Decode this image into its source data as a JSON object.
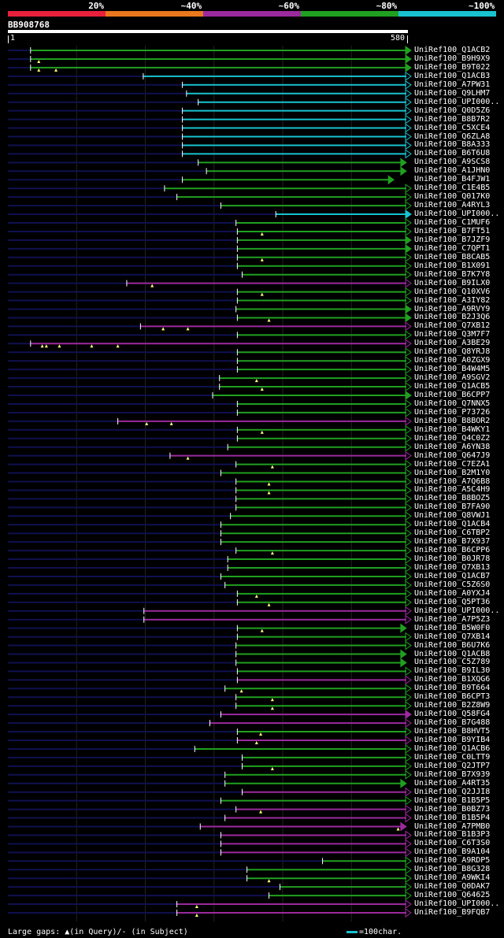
{
  "legend": [
    {
      "label": "20%",
      "color": "#e8203c"
    },
    {
      "label": "~40%",
      "color": "#e9781e"
    },
    {
      "label": "~60%",
      "color": "#9b2a9e"
    },
    {
      "label": "~80%",
      "color": "#20a020"
    },
    {
      "label": "~100%",
      "color": "#19c2cf"
    }
  ],
  "query": {
    "id": "BB908768",
    "start_label": "1",
    "end_label": "580",
    "length": 580
  },
  "colors": {
    "green": "#20a020",
    "cyan": "#19c2cf",
    "purple": "#9b2a9e",
    "tail": "#101050",
    "marker": "#ffff80",
    "grid": "#222222"
  },
  "hits": [
    {
      "label": "UniRef100_Q1ACB2",
      "start": 33,
      "end": 580,
      "color": "green",
      "arrow": true,
      "markers": []
    },
    {
      "label": "UniRef100_B9H9X9",
      "start": 33,
      "end": 580,
      "color": "green",
      "arrow": true,
      "markers": [
        45
      ]
    },
    {
      "label": "UniRef100_B9T022",
      "start": 33,
      "end": 580,
      "color": "green",
      "arrow": true,
      "markers": [
        45,
        70
      ]
    },
    {
      "label": "UniRef100_Q1ACB3",
      "start": 197,
      "end": 580,
      "color": "cyan",
      "arrow": false,
      "markers": []
    },
    {
      "label": "UniRef100_A7PW31",
      "start": 254,
      "end": 580,
      "color": "cyan",
      "arrow": false,
      "markers": []
    },
    {
      "label": "UniRef100_Q9LHM7",
      "start": 260,
      "end": 580,
      "color": "cyan",
      "arrow": false,
      "markers": []
    },
    {
      "label": "UniRef100_UPI000..",
      "start": 277,
      "end": 580,
      "color": "cyan",
      "arrow": false,
      "markers": []
    },
    {
      "label": "UniRef100_Q0D5Z6",
      "start": 254,
      "end": 580,
      "color": "cyan",
      "arrow": false,
      "markers": []
    },
    {
      "label": "UniRef100_B8B7R2",
      "start": 254,
      "end": 580,
      "color": "cyan",
      "arrow": false,
      "markers": []
    },
    {
      "label": "UniRef100_C5XCE4",
      "start": 254,
      "end": 580,
      "color": "cyan",
      "arrow": false,
      "markers": []
    },
    {
      "label": "UniRef100_Q6ZLA8",
      "start": 254,
      "end": 580,
      "color": "cyan",
      "arrow": false,
      "markers": []
    },
    {
      "label": "UniRef100_B8A333",
      "start": 254,
      "end": 580,
      "color": "cyan",
      "arrow": false,
      "markers": []
    },
    {
      "label": "UniRef100_B6T6U8",
      "start": 254,
      "end": 580,
      "color": "cyan",
      "arrow": false,
      "markers": []
    },
    {
      "label": "UniRef100_A9SCS8",
      "start": 277,
      "end": 573,
      "color": "green",
      "arrow": true,
      "markers": []
    },
    {
      "label": "UniRef100_A1JHN0",
      "start": 289,
      "end": 573,
      "color": "green",
      "arrow": true,
      "markers": []
    },
    {
      "label": "UniRef100_B4FJW1",
      "start": 254,
      "end": 555,
      "color": "green",
      "arrow": true,
      "markers": []
    },
    {
      "label": "UniRef100_C1E4B5",
      "start": 228,
      "end": 580,
      "color": "green",
      "arrow": false,
      "markers": []
    },
    {
      "label": "UniRef100_Q017K0",
      "start": 246,
      "end": 580,
      "color": "green",
      "arrow": false,
      "markers": []
    },
    {
      "label": "UniRef100_A4RYL3",
      "start": 310,
      "end": 580,
      "color": "green",
      "arrow": false,
      "markers": []
    },
    {
      "label": "UniRef100_UPI000..",
      "start": 390,
      "end": 580,
      "color": "cyan",
      "arrow": true,
      "markers": []
    },
    {
      "label": "UniRef100_C1MUF6",
      "start": 332,
      "end": 580,
      "color": "green",
      "arrow": false,
      "markers": []
    },
    {
      "label": "UniRef100_B7FT51",
      "start": 334,
      "end": 580,
      "color": "green",
      "arrow": false,
      "markers": [
        370
      ]
    },
    {
      "label": "UniRef100_B7JZF9",
      "start": 334,
      "end": 580,
      "color": "green",
      "arrow": true,
      "markers": []
    },
    {
      "label": "UniRef100_C7QPT1",
      "start": 334,
      "end": 580,
      "color": "green",
      "arrow": true,
      "markers": []
    },
    {
      "label": "UniRef100_B8CAB5",
      "start": 334,
      "end": 580,
      "color": "green",
      "arrow": false,
      "markers": [
        370
      ]
    },
    {
      "label": "UniRef100_B1X091",
      "start": 334,
      "end": 580,
      "color": "green",
      "arrow": false,
      "markers": []
    },
    {
      "label": "UniRef100_B7K7Y8",
      "start": 341,
      "end": 580,
      "color": "green",
      "arrow": false,
      "markers": []
    },
    {
      "label": "UniRef100_B9ILX0",
      "start": 173,
      "end": 580,
      "color": "purple",
      "arrow": false,
      "markers": [
        210
      ]
    },
    {
      "label": "UniRef100_Q10XV6",
      "start": 334,
      "end": 580,
      "color": "green",
      "arrow": false,
      "markers": [
        370
      ]
    },
    {
      "label": "UniRef100_A3IY82",
      "start": 334,
      "end": 580,
      "color": "green",
      "arrow": false,
      "markers": []
    },
    {
      "label": "UniRef100_A9RVY9",
      "start": 332,
      "end": 580,
      "color": "green",
      "arrow": true,
      "markers": []
    },
    {
      "label": "UniRef100_B2J3Q6",
      "start": 334,
      "end": 580,
      "color": "green",
      "arrow": true,
      "markers": [
        380
      ]
    },
    {
      "label": "UniRef100_Q7XB12",
      "start": 193,
      "end": 580,
      "color": "purple",
      "arrow": false,
      "markers": [
        226,
        262
      ]
    },
    {
      "label": "UniRef100_Q3M7F7",
      "start": 334,
      "end": 580,
      "color": "green",
      "arrow": false,
      "markers": []
    },
    {
      "label": "UniRef100_A3BE29",
      "start": 33,
      "end": 580,
      "color": "purple",
      "arrow": false,
      "markers": [
        50,
        56,
        75,
        122,
        160
      ]
    },
    {
      "label": "UniRef100_Q8YRJ8",
      "start": 334,
      "end": 580,
      "color": "green",
      "arrow": false,
      "markers": []
    },
    {
      "label": "UniRef100_A0ZGX9",
      "start": 334,
      "end": 580,
      "color": "green",
      "arrow": false,
      "markers": []
    },
    {
      "label": "UniRef100_B4W4M5",
      "start": 334,
      "end": 580,
      "color": "green",
      "arrow": false,
      "markers": []
    },
    {
      "label": "UniRef100_A9SGV2",
      "start": 308,
      "end": 580,
      "color": "green",
      "arrow": false,
      "markers": [
        362
      ]
    },
    {
      "label": "UniRef100_Q1ACB5",
      "start": 308,
      "end": 580,
      "color": "green",
      "arrow": false,
      "markers": [
        370
      ]
    },
    {
      "label": "UniRef100_B6CPP7",
      "start": 298,
      "end": 580,
      "color": "green",
      "arrow": true,
      "markers": []
    },
    {
      "label": "UniRef100_Q7NNX5",
      "start": 334,
      "end": 580,
      "color": "green",
      "arrow": false,
      "markers": []
    },
    {
      "label": "UniRef100_P73726",
      "start": 334,
      "end": 580,
      "color": "green",
      "arrow": false,
      "markers": []
    },
    {
      "label": "UniRef100_B8BOR2",
      "start": 160,
      "end": 580,
      "color": "purple",
      "arrow": false,
      "markers": [
        202,
        238
      ]
    },
    {
      "label": "UniRef100_B4WKY1",
      "start": 334,
      "end": 580,
      "color": "green",
      "arrow": false,
      "markers": [
        370
      ]
    },
    {
      "label": "UniRef100_Q4C0Z2",
      "start": 334,
      "end": 580,
      "color": "green",
      "arrow": false,
      "markers": []
    },
    {
      "label": "UniRef100_A6YN38",
      "start": 320,
      "end": 580,
      "color": "green",
      "arrow": false,
      "markers": []
    },
    {
      "label": "UniRef100_Q647J9",
      "start": 236,
      "end": 580,
      "color": "purple",
      "arrow": false,
      "markers": [
        262
      ]
    },
    {
      "label": "UniRef100_C7EZA1",
      "start": 332,
      "end": 580,
      "color": "green",
      "arrow": false,
      "markers": [
        385
      ]
    },
    {
      "label": "UniRef100_B2M1Y0",
      "start": 310,
      "end": 580,
      "color": "green",
      "arrow": false,
      "markers": []
    },
    {
      "label": "UniRef100_A7Q6B8",
      "start": 332,
      "end": 580,
      "color": "green",
      "arrow": false,
      "markers": [
        380
      ]
    },
    {
      "label": "UniRef100_A5C4H9",
      "start": 332,
      "end": 580,
      "color": "green",
      "arrow": false,
      "markers": [
        380
      ]
    },
    {
      "label": "UniRef100_B8BOZ5",
      "start": 332,
      "end": 580,
      "color": "green",
      "arrow": false,
      "markers": []
    },
    {
      "label": "UniRef100_B7FA90",
      "start": 332,
      "end": 580,
      "color": "green",
      "arrow": false,
      "markers": []
    },
    {
      "label": "UniRef100_Q8VWJ1",
      "start": 324,
      "end": 580,
      "color": "green",
      "arrow": false,
      "markers": []
    },
    {
      "label": "UniRef100_Q1ACB4",
      "start": 310,
      "end": 580,
      "color": "green",
      "arrow": false,
      "markers": []
    },
    {
      "label": "UniRef100_C6TBP2",
      "start": 310,
      "end": 580,
      "color": "green",
      "arrow": false,
      "markers": []
    },
    {
      "label": "UniRef100_B7X937",
      "start": 310,
      "end": 580,
      "color": "green",
      "arrow": false,
      "markers": []
    },
    {
      "label": "UniRef100_B6CPP6",
      "start": 332,
      "end": 580,
      "color": "green",
      "arrow": false,
      "markers": [
        385
      ]
    },
    {
      "label": "UniRef100_B0JR78",
      "start": 320,
      "end": 580,
      "color": "green",
      "arrow": false,
      "markers": []
    },
    {
      "label": "UniRef100_Q7XB13",
      "start": 320,
      "end": 580,
      "color": "green",
      "arrow": false,
      "markers": []
    },
    {
      "label": "UniRef100_Q1ACB7",
      "start": 310,
      "end": 580,
      "color": "green",
      "arrow": false,
      "markers": []
    },
    {
      "label": "UniRef100_C5Z6S0",
      "start": 316,
      "end": 580,
      "color": "green",
      "arrow": false,
      "markers": []
    },
    {
      "label": "UniRef100_A0YXJ4",
      "start": 334,
      "end": 580,
      "color": "green",
      "arrow": false,
      "markers": [
        362
      ]
    },
    {
      "label": "UniRef100_Q5PT36",
      "start": 334,
      "end": 580,
      "color": "green",
      "arrow": false,
      "markers": [
        380
      ]
    },
    {
      "label": "UniRef100_UPI000..",
      "start": 198,
      "end": 580,
      "color": "purple",
      "arrow": false,
      "markers": []
    },
    {
      "label": "UniRef100_A7P5Z3",
      "start": 198,
      "end": 580,
      "color": "purple",
      "arrow": false,
      "markers": []
    },
    {
      "label": "UniRef100_B5W0F0",
      "start": 334,
      "end": 573,
      "color": "green",
      "arrow": true,
      "markers": [
        370
      ]
    },
    {
      "label": "UniRef100_Q7XB14",
      "start": 334,
      "end": 580,
      "color": "green",
      "arrow": false,
      "markers": []
    },
    {
      "label": "UniRef100_B6U7K6",
      "start": 332,
      "end": 580,
      "color": "green",
      "arrow": false,
      "markers": []
    },
    {
      "label": "UniRef100_Q1ACB8",
      "start": 332,
      "end": 573,
      "color": "green",
      "arrow": true,
      "markers": []
    },
    {
      "label": "UniRef100_C5Z789",
      "start": 332,
      "end": 573,
      "color": "green",
      "arrow": true,
      "markers": []
    },
    {
      "label": "UniRef100_B9IL30",
      "start": 334,
      "end": 580,
      "color": "green",
      "arrow": false,
      "markers": []
    },
    {
      "label": "UniRef100_B1XQG6",
      "start": 334,
      "end": 580,
      "color": "purple",
      "arrow": false,
      "markers": []
    },
    {
      "label": "UniRef100_B9T664",
      "start": 316,
      "end": 580,
      "color": "green",
      "arrow": false,
      "markers": [
        340
      ]
    },
    {
      "label": "UniRef100_B6CPT3",
      "start": 332,
      "end": 580,
      "color": "green",
      "arrow": false,
      "markers": [
        385
      ]
    },
    {
      "label": "UniRef100_B2Z8W9",
      "start": 332,
      "end": 580,
      "color": "green",
      "arrow": false,
      "markers": [
        385
      ]
    },
    {
      "label": "UniRef100_Q58FG4",
      "start": 310,
      "end": 580,
      "color": "purple",
      "arrow": true,
      "markers": []
    },
    {
      "label": "UniRef100_B7G488",
      "start": 294,
      "end": 580,
      "color": "purple",
      "arrow": false,
      "markers": []
    },
    {
      "label": "UniRef100_B8HVT5",
      "start": 334,
      "end": 580,
      "color": "green",
      "arrow": false,
      "markers": [
        368
      ]
    },
    {
      "label": "UniRef100_B9YIB4",
      "start": 334,
      "end": 580,
      "color": "purple",
      "arrow": false,
      "markers": [
        362
      ]
    },
    {
      "label": "UniRef100_Q1ACB6",
      "start": 272,
      "end": 580,
      "color": "green",
      "arrow": false,
      "markers": []
    },
    {
      "label": "UniRef100_C0LTT9",
      "start": 341,
      "end": 580,
      "color": "green",
      "arrow": false,
      "markers": []
    },
    {
      "label": "UniRef100_Q2JTP7",
      "start": 341,
      "end": 580,
      "color": "green",
      "arrow": false,
      "markers": [
        385
      ]
    },
    {
      "label": "UniRef100_B7X939",
      "start": 316,
      "end": 580,
      "color": "green",
      "arrow": false,
      "markers": []
    },
    {
      "label": "UniRef100_A4RT35",
      "start": 316,
      "end": 573,
      "color": "green",
      "arrow": true,
      "markers": []
    },
    {
      "label": "UniRef100_Q2JJI8",
      "start": 341,
      "end": 580,
      "color": "purple",
      "arrow": false,
      "markers": []
    },
    {
      "label": "UniRef100_B1B5P5",
      "start": 310,
      "end": 580,
      "color": "green",
      "arrow": false,
      "markers": []
    },
    {
      "label": "UniRef100_B0BZ73",
      "start": 332,
      "end": 580,
      "color": "purple",
      "arrow": false,
      "markers": [
        368
      ]
    },
    {
      "label": "UniRef100_B1B5P4",
      "start": 316,
      "end": 580,
      "color": "purple",
      "arrow": false,
      "markers": []
    },
    {
      "label": "UniRef100_A7PMB0",
      "start": 280,
      "end": 573,
      "color": "purple",
      "arrow": true,
      "markers": [
        568
      ]
    },
    {
      "label": "UniRef100_B1B3P3",
      "start": 310,
      "end": 580,
      "color": "purple",
      "arrow": false,
      "markers": []
    },
    {
      "label": "UniRef100_C6T3S0",
      "start": 310,
      "end": 580,
      "color": "purple",
      "arrow": false,
      "markers": []
    },
    {
      "label": "UniRef100_B9A104",
      "start": 310,
      "end": 580,
      "color": "purple",
      "arrow": false,
      "markers": []
    },
    {
      "label": "UniRef100_A9RDP5",
      "start": 458,
      "end": 580,
      "color": "green",
      "arrow": false,
      "markers": []
    },
    {
      "label": "UniRef100_B8G328",
      "start": 348,
      "end": 580,
      "color": "green",
      "arrow": false,
      "markers": []
    },
    {
      "label": "UniRef100_A9WKI4",
      "start": 348,
      "end": 580,
      "color": "green",
      "arrow": false,
      "markers": [
        380
      ]
    },
    {
      "label": "UniRef100_Q0DAK7",
      "start": 396,
      "end": 580,
      "color": "green",
      "arrow": false,
      "markers": []
    },
    {
      "label": "UniRef100_Q64625",
      "start": 380,
      "end": 580,
      "color": "green",
      "arrow": false,
      "markers": []
    },
    {
      "label": "UniRef100_UPI000..",
      "start": 246,
      "end": 580,
      "color": "purple",
      "arrow": false,
      "markers": [
        275
      ]
    },
    {
      "label": "UniRef100_B9FQB7",
      "start": 246,
      "end": 580,
      "color": "purple",
      "arrow": false,
      "markers": [
        275
      ]
    }
  ],
  "footer": {
    "text": "Large gaps: ▲(in Query)/- (in Subject)"
  },
  "scale_key": {
    "text": "=100char."
  }
}
